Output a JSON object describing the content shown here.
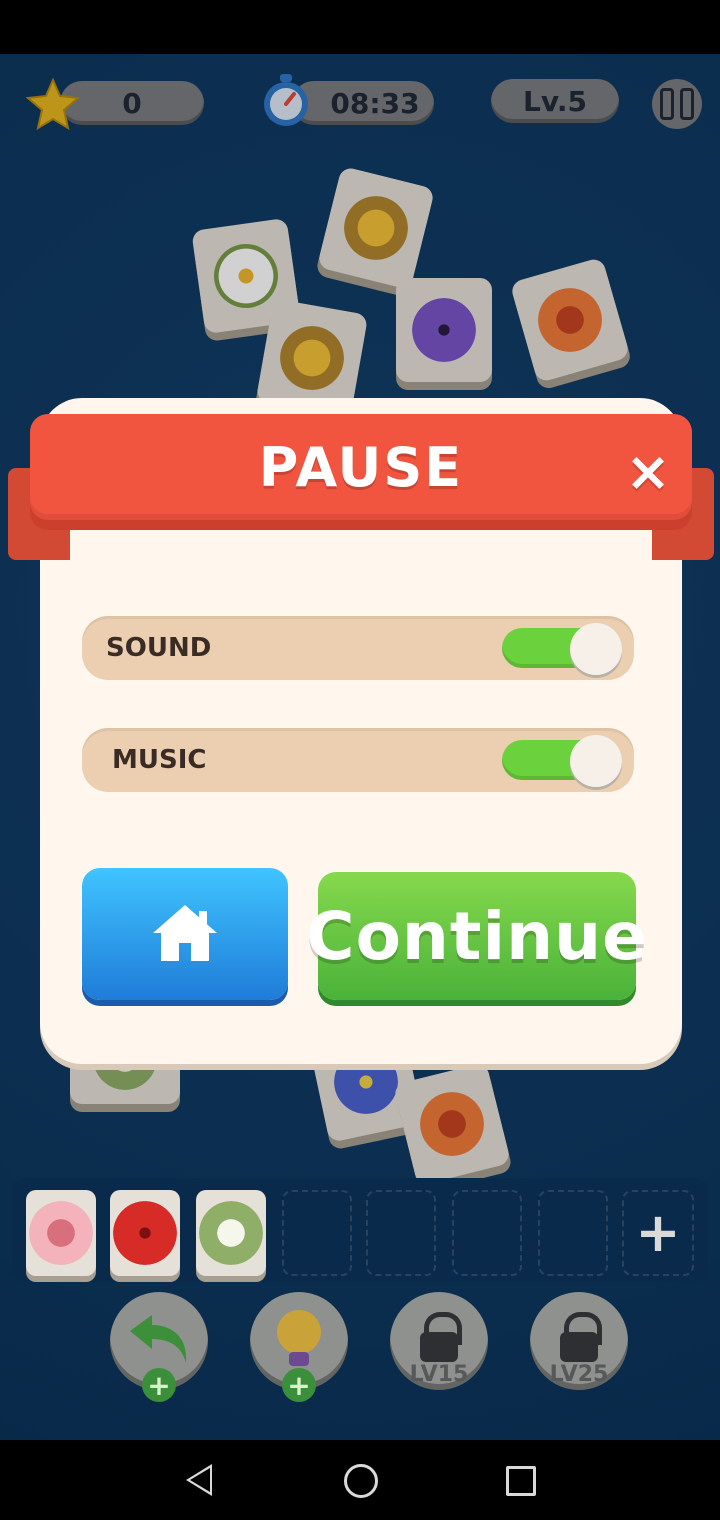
{
  "hud": {
    "score": "0",
    "timer": "08:33",
    "level": "Lv.5"
  },
  "dialog": {
    "title": "PAUSE",
    "close_icon": "×",
    "settings": [
      {
        "label": "SOUND",
        "enabled": true
      },
      {
        "label": "MUSIC",
        "enabled": true
      }
    ],
    "continue_label": "Continue"
  },
  "boosters": [
    {
      "icon": "undo-arrow-icon",
      "locked": false
    },
    {
      "icon": "hint-lightbulb-icon",
      "locked": false
    },
    {
      "icon": "lock-icon",
      "locked": true,
      "label": "LV15"
    },
    {
      "icon": "lock-icon",
      "locked": true,
      "label": "LV25"
    }
  ],
  "tray": {
    "slots_total": 7,
    "filled": [
      "rose",
      "red-hibiscus",
      "white-jasmine"
    ],
    "add_symbol": "+"
  },
  "colors": {
    "ribbon": "#f2553f",
    "toggle_on": "#6bd13d",
    "home_button": "#2b8fe6",
    "continue_button": "#55b83a"
  }
}
